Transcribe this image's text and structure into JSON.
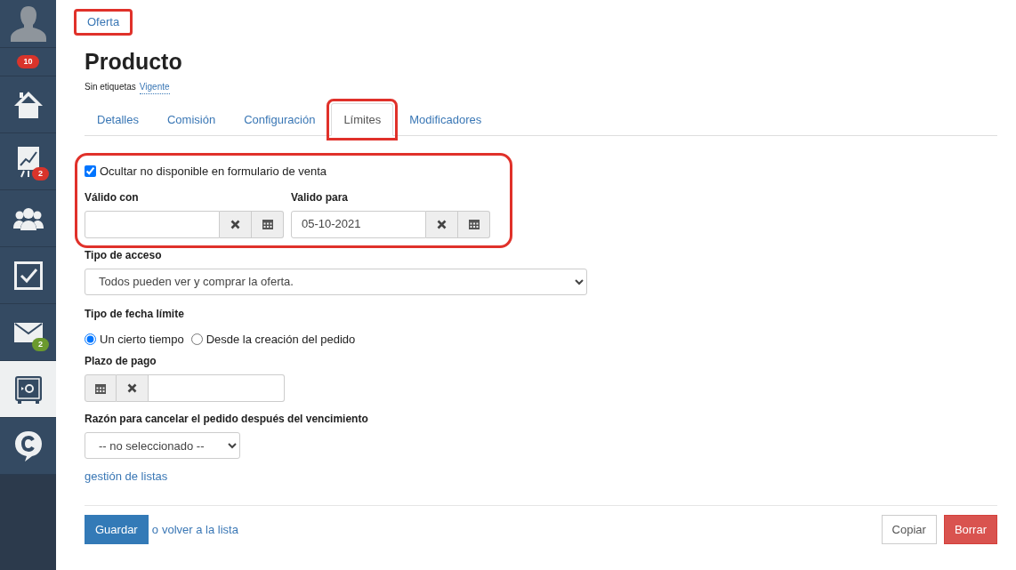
{
  "sidebar": {
    "items": [
      {
        "kind": "avatar",
        "selected": false
      },
      {
        "kind": "counter",
        "selected": false,
        "badge": {
          "text": "10",
          "color": "#d9342b"
        }
      },
      {
        "kind": "home",
        "selected": false
      },
      {
        "kind": "chart",
        "selected": false,
        "badge": {
          "text": "2",
          "color": "#d9342b"
        }
      },
      {
        "kind": "people",
        "selected": false
      },
      {
        "kind": "tasks",
        "selected": false
      },
      {
        "kind": "mail",
        "selected": false,
        "badge": {
          "text": "2",
          "color": "#6b9a2e"
        }
      },
      {
        "kind": "safe",
        "selected": true
      },
      {
        "kind": "chat",
        "selected": false
      }
    ]
  },
  "breadcrumb": {
    "label": "Oferta",
    "highlighted": true
  },
  "title": "Producto",
  "tags": {
    "label": "Sin etiquetas",
    "status": "Vigente"
  },
  "tabs": [
    {
      "label": "Detalles",
      "selected": false,
      "highlighted": false
    },
    {
      "label": "Comisión",
      "selected": false,
      "highlighted": false
    },
    {
      "label": "Configuración",
      "selected": false,
      "highlighted": false
    },
    {
      "label": "Límites",
      "selected": true,
      "highlighted": true
    },
    {
      "label": "Modificadores",
      "selected": false,
      "highlighted": false
    }
  ],
  "limits_section": {
    "highlighted": true,
    "hide_unavailable": {
      "label": "Ocultar no disponible en formulario de venta",
      "checked": true
    },
    "valid_from": {
      "label": "Válido con"
    },
    "valid_to": {
      "label": "Valido para",
      "value": "05-10-2021"
    }
  },
  "access_type": {
    "label": "Tipo de acceso",
    "value": "Todos pueden ver y comprar la oferta."
  },
  "deadline_type": {
    "label": "Tipo de fecha límite",
    "options": [
      {
        "label": "Un cierto tiempo",
        "selected": true
      },
      {
        "label": "Desde la creación del pedido",
        "selected": false
      }
    ]
  },
  "payment_term": {
    "label": "Plazo de pago"
  },
  "cancel_reason": {
    "label": "Razón para cancelar el pedido después del vencimiento",
    "value": "-- no seleccionado --"
  },
  "list_management_link": "gestión de listas",
  "footer": {
    "save": "Guardar",
    "or_text": "o",
    "back_link": "volver a la lista",
    "copy": "Copiar",
    "delete": "Borrar"
  }
}
